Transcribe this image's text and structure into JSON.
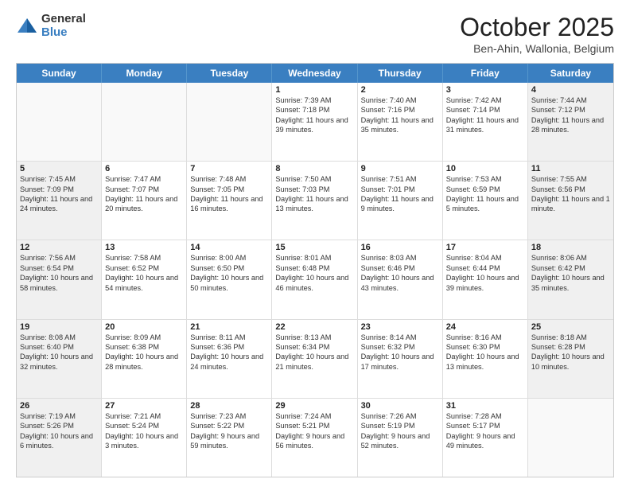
{
  "logo": {
    "general": "General",
    "blue": "Blue"
  },
  "header": {
    "month": "October 2025",
    "location": "Ben-Ahin, Wallonia, Belgium"
  },
  "days_of_week": [
    "Sunday",
    "Monday",
    "Tuesday",
    "Wednesday",
    "Thursday",
    "Friday",
    "Saturday"
  ],
  "weeks": [
    [
      {
        "num": "",
        "info": "",
        "empty": true
      },
      {
        "num": "",
        "info": "",
        "empty": true
      },
      {
        "num": "",
        "info": "",
        "empty": true
      },
      {
        "num": "1",
        "info": "Sunrise: 7:39 AM\nSunset: 7:18 PM\nDaylight: 11 hours and 39 minutes."
      },
      {
        "num": "2",
        "info": "Sunrise: 7:40 AM\nSunset: 7:16 PM\nDaylight: 11 hours and 35 minutes."
      },
      {
        "num": "3",
        "info": "Sunrise: 7:42 AM\nSunset: 7:14 PM\nDaylight: 11 hours and 31 minutes."
      },
      {
        "num": "4",
        "info": "Sunrise: 7:44 AM\nSunset: 7:12 PM\nDaylight: 11 hours and 28 minutes."
      }
    ],
    [
      {
        "num": "5",
        "info": "Sunrise: 7:45 AM\nSunset: 7:09 PM\nDaylight: 11 hours and 24 minutes."
      },
      {
        "num": "6",
        "info": "Sunrise: 7:47 AM\nSunset: 7:07 PM\nDaylight: 11 hours and 20 minutes."
      },
      {
        "num": "7",
        "info": "Sunrise: 7:48 AM\nSunset: 7:05 PM\nDaylight: 11 hours and 16 minutes."
      },
      {
        "num": "8",
        "info": "Sunrise: 7:50 AM\nSunset: 7:03 PM\nDaylight: 11 hours and 13 minutes."
      },
      {
        "num": "9",
        "info": "Sunrise: 7:51 AM\nSunset: 7:01 PM\nDaylight: 11 hours and 9 minutes."
      },
      {
        "num": "10",
        "info": "Sunrise: 7:53 AM\nSunset: 6:59 PM\nDaylight: 11 hours and 5 minutes."
      },
      {
        "num": "11",
        "info": "Sunrise: 7:55 AM\nSunset: 6:56 PM\nDaylight: 11 hours and 1 minute."
      }
    ],
    [
      {
        "num": "12",
        "info": "Sunrise: 7:56 AM\nSunset: 6:54 PM\nDaylight: 10 hours and 58 minutes."
      },
      {
        "num": "13",
        "info": "Sunrise: 7:58 AM\nSunset: 6:52 PM\nDaylight: 10 hours and 54 minutes."
      },
      {
        "num": "14",
        "info": "Sunrise: 8:00 AM\nSunset: 6:50 PM\nDaylight: 10 hours and 50 minutes."
      },
      {
        "num": "15",
        "info": "Sunrise: 8:01 AM\nSunset: 6:48 PM\nDaylight: 10 hours and 46 minutes."
      },
      {
        "num": "16",
        "info": "Sunrise: 8:03 AM\nSunset: 6:46 PM\nDaylight: 10 hours and 43 minutes."
      },
      {
        "num": "17",
        "info": "Sunrise: 8:04 AM\nSunset: 6:44 PM\nDaylight: 10 hours and 39 minutes."
      },
      {
        "num": "18",
        "info": "Sunrise: 8:06 AM\nSunset: 6:42 PM\nDaylight: 10 hours and 35 minutes."
      }
    ],
    [
      {
        "num": "19",
        "info": "Sunrise: 8:08 AM\nSunset: 6:40 PM\nDaylight: 10 hours and 32 minutes."
      },
      {
        "num": "20",
        "info": "Sunrise: 8:09 AM\nSunset: 6:38 PM\nDaylight: 10 hours and 28 minutes."
      },
      {
        "num": "21",
        "info": "Sunrise: 8:11 AM\nSunset: 6:36 PM\nDaylight: 10 hours and 24 minutes."
      },
      {
        "num": "22",
        "info": "Sunrise: 8:13 AM\nSunset: 6:34 PM\nDaylight: 10 hours and 21 minutes."
      },
      {
        "num": "23",
        "info": "Sunrise: 8:14 AM\nSunset: 6:32 PM\nDaylight: 10 hours and 17 minutes."
      },
      {
        "num": "24",
        "info": "Sunrise: 8:16 AM\nSunset: 6:30 PM\nDaylight: 10 hours and 13 minutes."
      },
      {
        "num": "25",
        "info": "Sunrise: 8:18 AM\nSunset: 6:28 PM\nDaylight: 10 hours and 10 minutes."
      }
    ],
    [
      {
        "num": "26",
        "info": "Sunrise: 7:19 AM\nSunset: 5:26 PM\nDaylight: 10 hours and 6 minutes."
      },
      {
        "num": "27",
        "info": "Sunrise: 7:21 AM\nSunset: 5:24 PM\nDaylight: 10 hours and 3 minutes."
      },
      {
        "num": "28",
        "info": "Sunrise: 7:23 AM\nSunset: 5:22 PM\nDaylight: 9 hours and 59 minutes."
      },
      {
        "num": "29",
        "info": "Sunrise: 7:24 AM\nSunset: 5:21 PM\nDaylight: 9 hours and 56 minutes."
      },
      {
        "num": "30",
        "info": "Sunrise: 7:26 AM\nSunset: 5:19 PM\nDaylight: 9 hours and 52 minutes."
      },
      {
        "num": "31",
        "info": "Sunrise: 7:28 AM\nSunset: 5:17 PM\nDaylight: 9 hours and 49 minutes."
      },
      {
        "num": "",
        "info": "",
        "empty": true
      }
    ]
  ]
}
